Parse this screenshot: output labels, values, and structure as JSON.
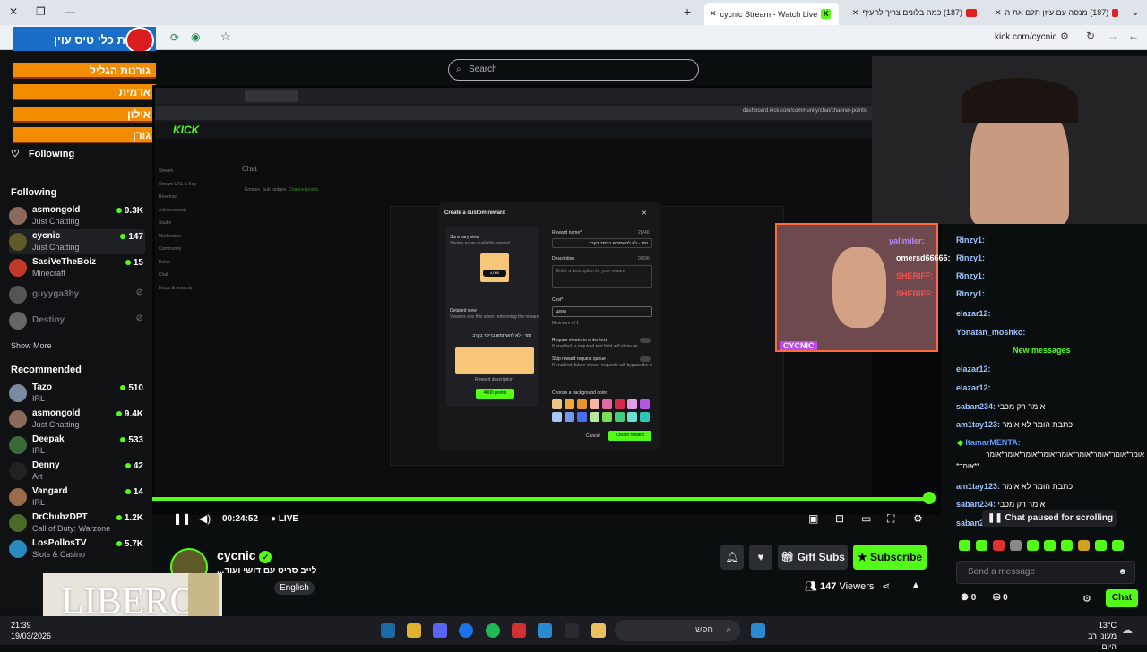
{
  "browser": {
    "tabs": [
      {
        "label": "cycnic Stream - Watch Live",
        "active": true
      },
      {
        "label": "(187) כמה בלונים צריך להעיף"
      },
      {
        "label": "(187) מנסה עם עיזן תלם את ה"
      }
    ],
    "url": "kick.com/cycnic"
  },
  "overlay": {
    "top_logo_text": "חדירת כלי טיס עוין",
    "bars": [
      "גורנות הגליל",
      "אדמית",
      "אילון",
      "גורן"
    ]
  },
  "search": {
    "placeholder": "Search"
  },
  "sidebar": {
    "following_top": "Following",
    "following_header": "Following",
    "following": [
      {
        "name": "asmongold",
        "game": "Just Chatting",
        "viewers": "9.3K"
      },
      {
        "name": "cycnic",
        "game": "Just Chatting",
        "viewers": "147"
      },
      {
        "name": "SasiVeTheBoiz",
        "game": "Minecraft",
        "viewers": "15"
      },
      {
        "name": "guyyga3hy",
        "game": "",
        "viewers": ""
      },
      {
        "name": "Destiny",
        "game": "",
        "viewers": ""
      }
    ],
    "show_more": "Show More",
    "recommended_header": "Recommended",
    "recommended": [
      {
        "name": "Tazo",
        "game": "IRL",
        "viewers": "510"
      },
      {
        "name": "asmongold",
        "game": "Just Chatting",
        "viewers": "9.4K"
      },
      {
        "name": "Deepak",
        "game": "IRL",
        "viewers": "533"
      },
      {
        "name": "Denny",
        "game": "Art",
        "viewers": "42"
      },
      {
        "name": "Vangard",
        "game": "IRL",
        "viewers": "14"
      },
      {
        "name": "DrChubzDPT",
        "game": "Call of Duty: Warzone",
        "viewers": "1.2K"
      },
      {
        "name": "LosPollosTV",
        "game": "Slots & Casino",
        "viewers": "5.7K"
      }
    ]
  },
  "dashboard": {
    "url": "dashboard.kick.com/community/chat/channel-points",
    "page_title": "Chat",
    "tabs": [
      "Emotes",
      "Sub badges",
      "Channel points"
    ],
    "nav": [
      "Stream",
      "Stream URL & Key",
      "Revenue",
      "Achievements",
      "Studio",
      "Moderation",
      "Community",
      "Roles",
      "Chat",
      "Drops & rewards"
    ]
  },
  "modal": {
    "title": "Create a custom reward",
    "summary_label": "Summary view",
    "summary_sub": "Shown as an available reward",
    "points": "4,000",
    "detailed_label": "Detailed view",
    "detailed_sub": "Viewers see this when redeeming the reward",
    "reward_title": "זמר - לא להשתמש בריפר בקרב",
    "reward_description": "Reward description",
    "redeem_button": "4000 points",
    "name_label": "Reward name*",
    "name_count": "28/40",
    "description_label": "Description",
    "description_count": "0/200",
    "description_placeholder": "Enter a description for your reward",
    "cost_label": "Cost*",
    "cost_value": "4000",
    "cost_min": "Minimum of 1",
    "toggle1": "Require viewer to enter text",
    "toggle1_sub": "If enabled, a required text field will show up",
    "toggle2": "Skip reward request queue",
    "toggle2_sub": "If enabled, future viewer requests will bypass the rewards queue",
    "bg_label": "Choose a background color",
    "cancel": "Cancel",
    "create": "Create reward",
    "swatches": [
      "#e8c98a",
      "#f2a93b",
      "#e8912e",
      "#f5b6a9",
      "#e36aa0",
      "#d42a4a",
      "#e29ee6",
      "#b15ae0",
      "#a9c7f5",
      "#6f9cf0",
      "#4b6ef0",
      "#b7e8a0",
      "#7bdc57",
      "#3fcf7f",
      "#6be0d0",
      "#2ec4b6"
    ]
  },
  "cam": {
    "name": "CYCNIC"
  },
  "video_controls": {
    "time": "00:24:52",
    "live": "LIVE"
  },
  "stream": {
    "channel": "cycnic",
    "title": "לייב סריט עם דושי ועוד...",
    "tag": "English",
    "viewers": "147",
    "viewers_label": "Viewers",
    "gift_subs": "Gift Subs",
    "subscribe": "Subscribe"
  },
  "chat": {
    "messages_top": [
      {
        "user": "yalimiler:",
        "text": "",
        "color": "#b388ff"
      },
      {
        "user": "omersd66666:",
        "text": "",
        "color": "#ffffff"
      },
      {
        "user": "SHERIFF:",
        "text": "",
        "color": "#ff4d4d"
      },
      {
        "user": "SHERIFF:",
        "text": "",
        "color": "#ff4d4d"
      }
    ],
    "rinzy": [
      "Rinzy1:",
      "Rinzy1:",
      "Rinzy1:",
      "Rinzy1:"
    ],
    "messages": [
      {
        "user": "elazar12:",
        "text": "",
        "color": "#a0c4ff"
      },
      {
        "user": "Yonatan_moshko:",
        "text": "",
        "color": "#a0c4ff"
      }
    ],
    "new_messages": "New messages",
    "messages2": [
      {
        "user": "elazar12:",
        "text": "",
        "color": "#a0c4ff"
      },
      {
        "user": "elazar12:",
        "text": "",
        "color": "#a0c4ff"
      },
      {
        "user": "saban234:",
        "text": "אומר רק מכבי",
        "color": "#a0c4ff"
      },
      {
        "user": "am1tay123:",
        "text": "כתבת הומר לא אומר",
        "color": "#a0c4ff"
      },
      {
        "user": "ItamarMENTA:",
        "text": "",
        "color": "#5b9cff"
      }
    ],
    "spam_line1": "אומר*אומר*אומר*אומר*אומר*אומר*אומר*אומר*אומר",
    "spam_line2": "*אומר**",
    "messages3": [
      {
        "user": "am1tay123:",
        "text": "כתבת הומר לא אומר",
        "color": "#a0c4ff"
      },
      {
        "user": "saban234:",
        "text": "אומר רק מכבי",
        "color": "#a0c4ff"
      },
      {
        "user": "saban2",
        "text": "",
        "color": "#a0c4ff"
      }
    ],
    "paused": "Chat paused for scrolling",
    "send_placeholder": "Send a message",
    "points": "0",
    "rewards": "0",
    "chat_button": "Chat"
  },
  "taskbar": {
    "time": "21:39",
    "date": "19/03/2026",
    "search": "חפש",
    "weather_temp": "13°C",
    "weather_text": "מעונן רב היום"
  },
  "ad": {
    "text": "LIBERO"
  }
}
